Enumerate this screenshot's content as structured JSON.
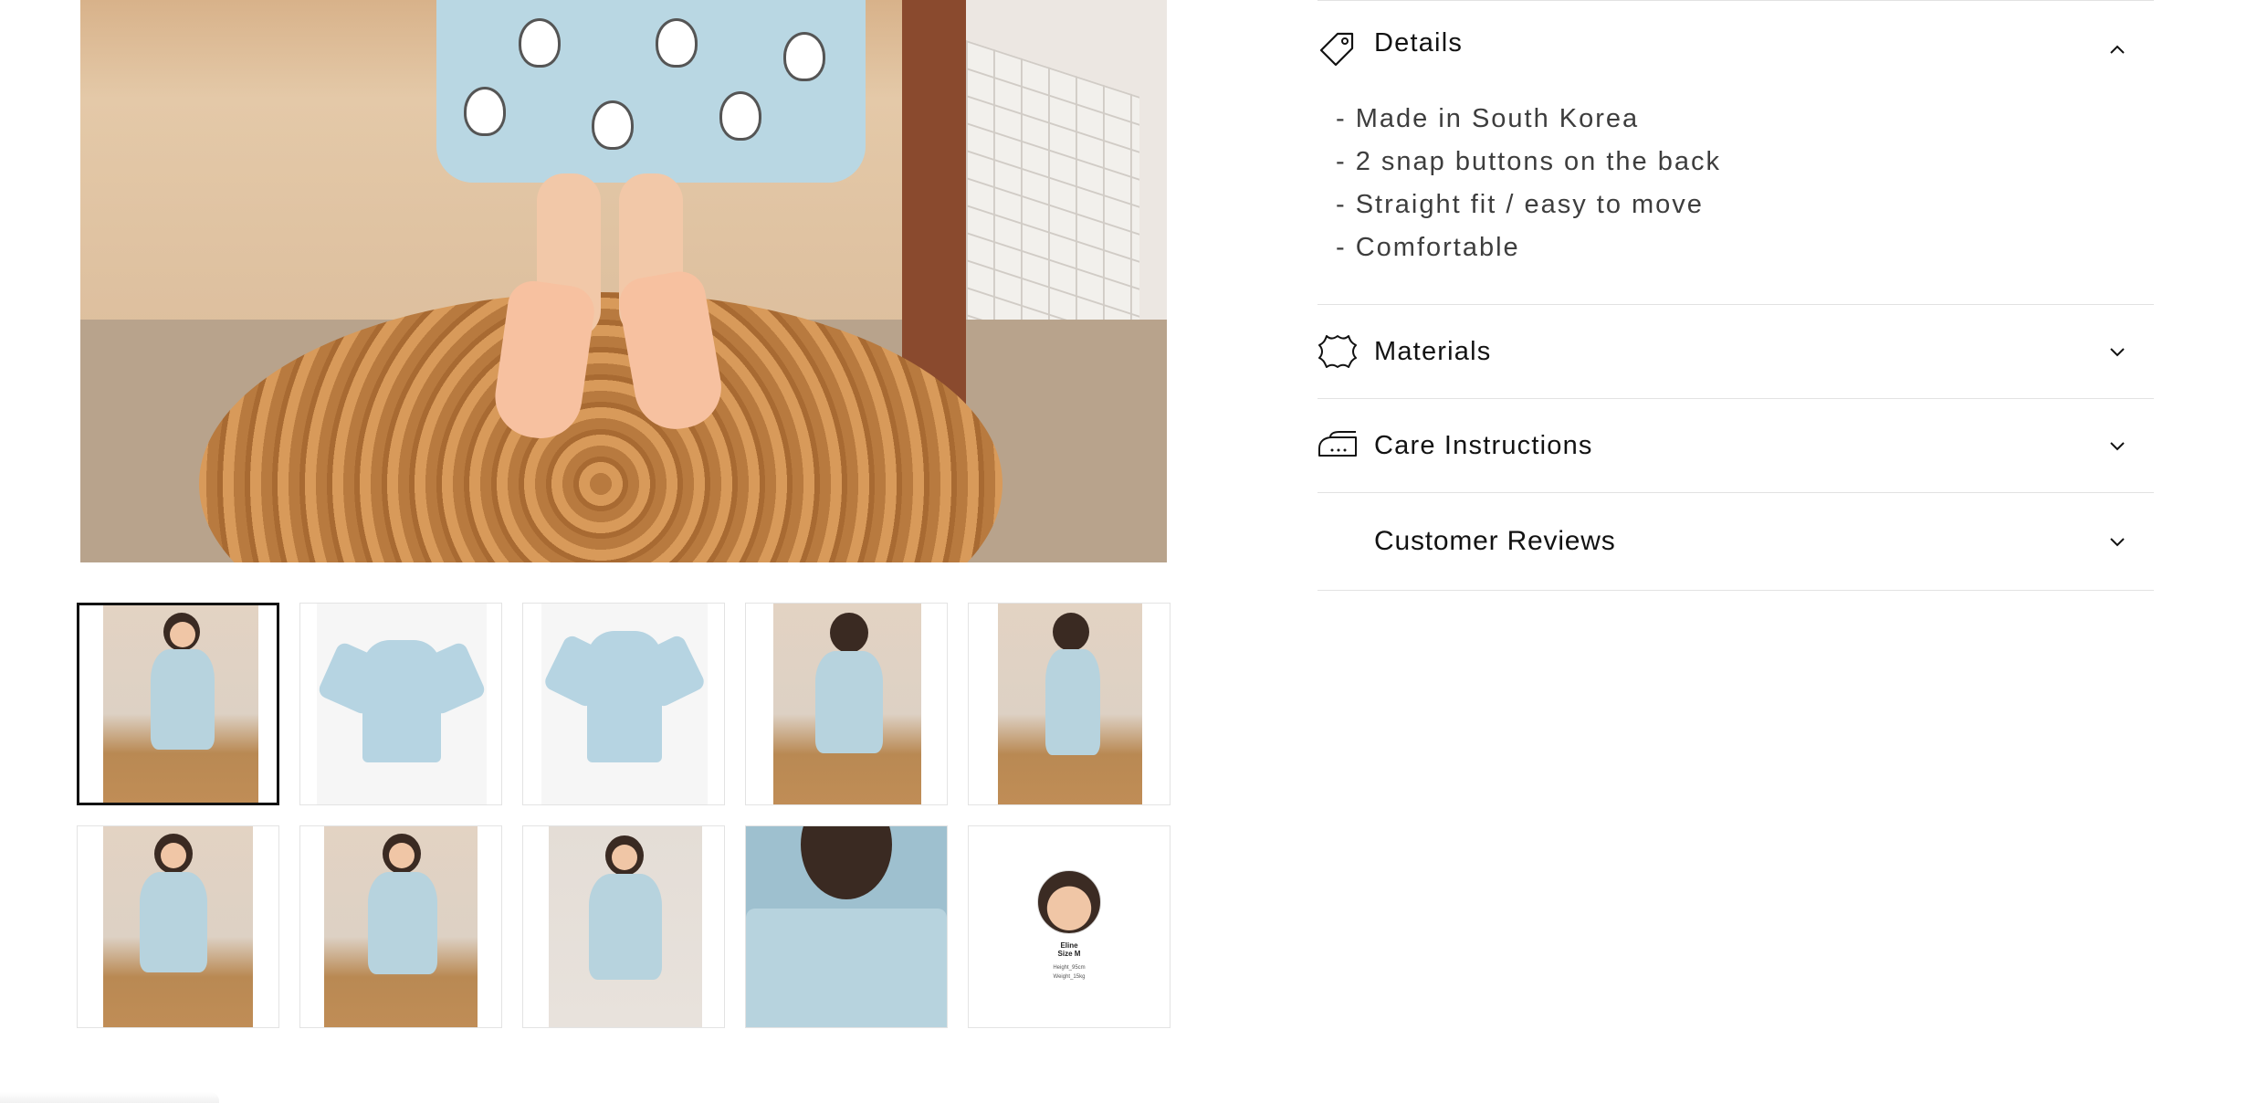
{
  "gallery": {
    "main_image_alt": "",
    "thumbnails": [
      {
        "kind": "room",
        "active": true
      },
      {
        "kind": "studio-front",
        "active": false
      },
      {
        "kind": "studio-back",
        "active": false
      },
      {
        "kind": "room-back",
        "active": false
      },
      {
        "kind": "room-side",
        "active": false
      },
      {
        "kind": "room-wave",
        "active": false
      },
      {
        "kind": "room-bench",
        "active": false
      },
      {
        "kind": "plain-standing",
        "active": false
      },
      {
        "kind": "back-closeup",
        "active": false
      },
      {
        "kind": "profile",
        "active": false
      }
    ],
    "profile_card": {
      "name": "Eline",
      "size": "Size M",
      "height": "Height_95cm",
      "weight": "Weight_15kg"
    }
  },
  "accordion": {
    "details": {
      "title": "Details",
      "expanded": true,
      "lines": [
        "- Made in South Korea",
        "- 2 snap buttons on the back",
        "- Straight fit / easy to move",
        "- Comfortable"
      ]
    },
    "materials": {
      "title": "Materials",
      "expanded": false
    },
    "care": {
      "title": "Care Instructions",
      "expanded": false
    },
    "reviews": {
      "title": "Customer Reviews",
      "expanded": false
    }
  },
  "icons": {
    "details": "tag-icon",
    "materials": "leather-icon",
    "care": "iron-icon",
    "chevron_up": "chevron-up-icon",
    "chevron_down": "chevron-down-icon"
  },
  "colors": {
    "text": "#121212",
    "border": "#e2e2e2",
    "dress_blue": "#b7d3de"
  }
}
